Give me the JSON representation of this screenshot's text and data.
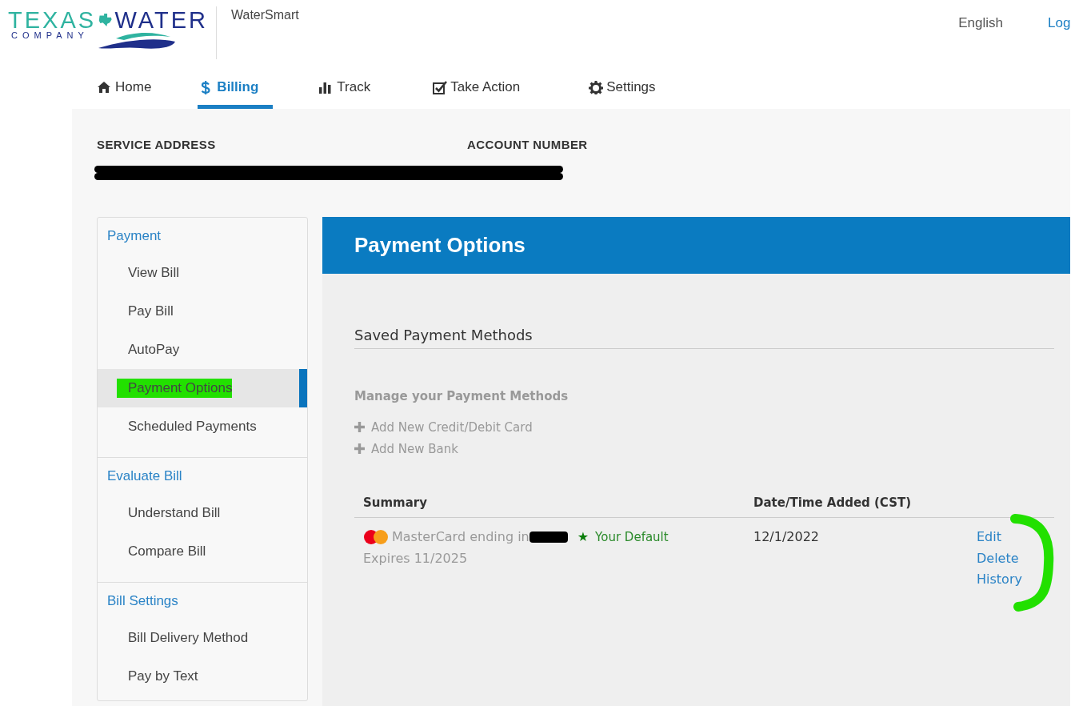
{
  "header": {
    "logo": {
      "word_1": "TEXAS",
      "word_2": "WATER",
      "tagline": "COMPANY"
    },
    "app_name": "WaterSmart",
    "language": "English",
    "login_link": "Log"
  },
  "nav_tabs": [
    {
      "label": "Home",
      "selected": false
    },
    {
      "label": "Billing",
      "selected": true
    },
    {
      "label": "Track",
      "selected": false
    },
    {
      "label": "Take Action",
      "selected": false
    },
    {
      "label": "Settings",
      "selected": false
    }
  ],
  "account": {
    "fields": [
      {
        "label": "SERVICE ADDRESS"
      },
      {
        "label": "ACCOUNT NUMBER"
      }
    ],
    "values_redacted": true
  },
  "sidebar": {
    "sections": [
      {
        "title": "Payment",
        "items": [
          {
            "label": "View Bill",
            "selected": false,
            "highlighted": false
          },
          {
            "label": "Pay Bill",
            "selected": false,
            "highlighted": false
          },
          {
            "label": "AutoPay",
            "selected": false,
            "highlighted": false
          },
          {
            "label": "Payment Options",
            "selected": true,
            "highlighted": true
          },
          {
            "label": "Scheduled Payments",
            "selected": false,
            "highlighted": false
          }
        ]
      },
      {
        "title": "Evaluate Bill",
        "items": [
          {
            "label": "Understand Bill",
            "selected": false,
            "highlighted": false
          },
          {
            "label": "Compare Bill",
            "selected": false,
            "highlighted": false
          }
        ]
      },
      {
        "title": "Bill Settings",
        "items": [
          {
            "label": "Bill Delivery Method",
            "selected": false,
            "highlighted": false
          },
          {
            "label": "Pay by Text",
            "selected": false,
            "highlighted": false
          }
        ]
      }
    ]
  },
  "main": {
    "title": "Payment Options",
    "section_title": "Saved Payment Methods",
    "manage_title": "Manage your Payment Methods",
    "add_links": [
      "Add New Credit/Debit Card",
      "Add New Bank"
    ],
    "table": {
      "columns": [
        "Summary",
        "Date/Time Added (CST)"
      ],
      "rows": [
        {
          "card": "MasterCard ending in",
          "number_redacted": true,
          "default_mark": "★",
          "default_label": "Your Default",
          "expires": "Expires 11/2025",
          "date": "12/1/2022",
          "actions": [
            "Edit",
            "Delete",
            "History"
          ],
          "actions_annotated": true
        }
      ]
    }
  }
}
